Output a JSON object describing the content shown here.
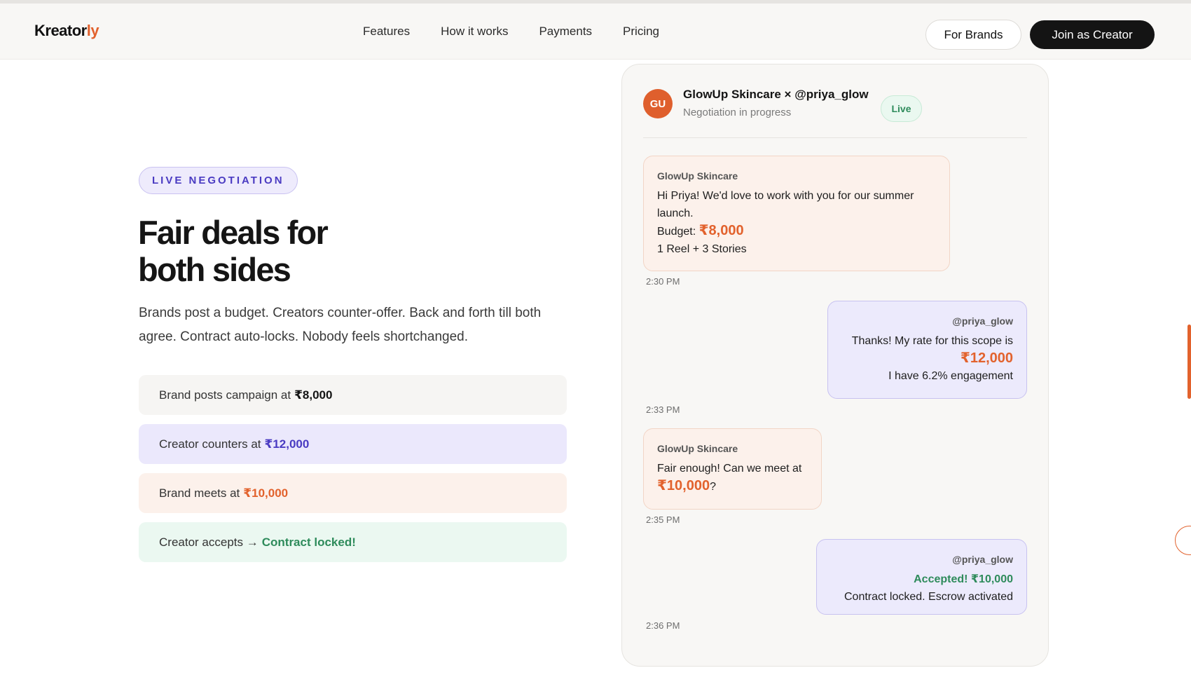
{
  "nav": {
    "logo_main": "Kreator",
    "logo_accent": "ly",
    "links": [
      "Features",
      "How it works",
      "Payments",
      "Pricing"
    ],
    "for_brands": "For Brands",
    "join_creator": "Join as Creator"
  },
  "hero": {
    "badge": "LIVE NEGOTIATION",
    "headline_line1": "Fair deals for",
    "headline_line2": "both sides",
    "subtext": "Brands post a budget. Creators counter-offer. Back and forth till both agree. Contract auto-locks. Nobody feels shortchanged."
  },
  "steps": [
    {
      "text": "Brand posts campaign at",
      "amount": "₹8,000"
    },
    {
      "text": "Creator counters at",
      "amount": "₹12,000"
    },
    {
      "text": "Brand meets at",
      "amount": "₹10,000"
    },
    {
      "text": "Creator accepts →",
      "amount": "Contract locked!"
    }
  ],
  "chat": {
    "avatar_initials": "GU",
    "title": "GlowUp Skincare × @priya_glow",
    "status": "Negotiation in progress",
    "live_label": "Live",
    "messages": [
      {
        "sender": "GlowUp Skincare",
        "line1": "Hi Priya! We'd love to work with you for our summer launch.",
        "budget_label": "Budget:",
        "budget_amount": "₹8,000",
        "line3": "1 Reel + 3 Stories",
        "time": "2:30 PM"
      },
      {
        "sender": "@priya_glow",
        "line1": "Thanks! My rate for this scope is",
        "amount": "₹12,000",
        "line3": "I have 6.2% engagement",
        "time": "2:33 PM"
      },
      {
        "sender": "GlowUp Skincare",
        "line1": "Fair enough! Can we meet at",
        "amount": "₹10,000",
        "suffix": "?",
        "time": "2:35 PM"
      },
      {
        "sender": "@priya_glow",
        "accepted": "Accepted! ₹10,000",
        "line2": "Contract locked. Escrow activated",
        "time": "2:36 PM"
      }
    ]
  },
  "colors": {
    "accent_orange": "#e2622d",
    "accent_purple": "#4a3bc2",
    "accent_green": "#2e8b5b",
    "dark": "#141414"
  }
}
